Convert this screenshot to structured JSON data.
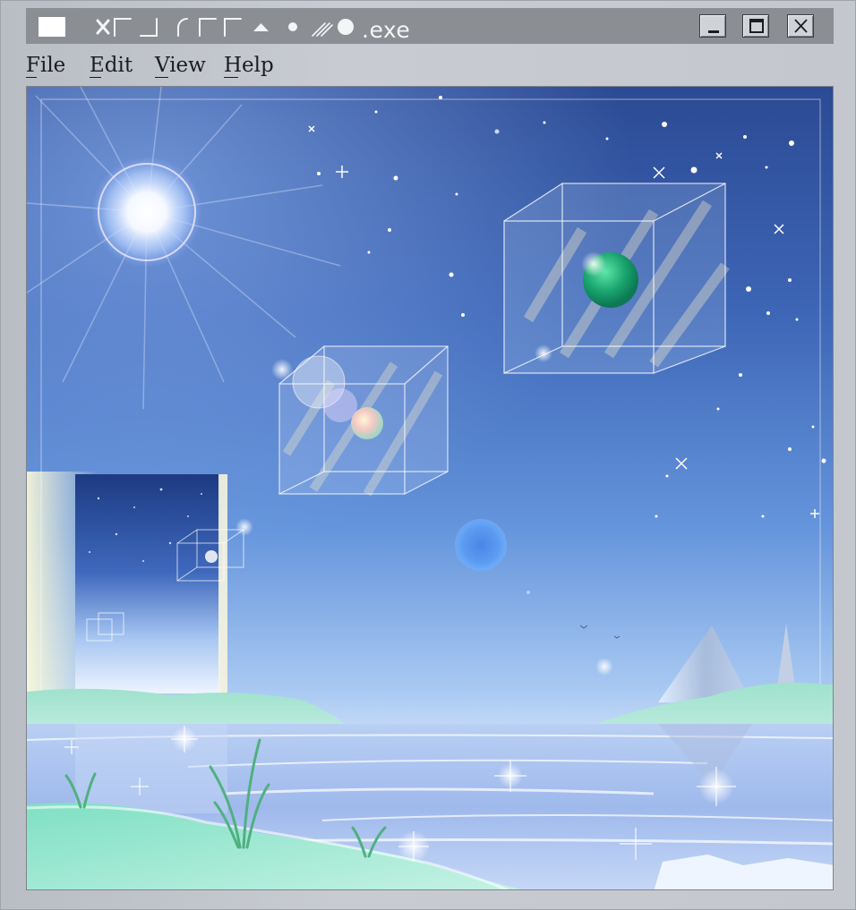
{
  "window": {
    "title": ".exe",
    "title_icon_glyphs": [
      "x-icon",
      "corner-icon",
      "corner-icon",
      "arc-icon",
      "corner-icon",
      "corner-icon",
      "triangle-icon",
      "dot-icon",
      "slash-icon",
      "circle-icon"
    ],
    "controls": {
      "minimize": "minimize-icon",
      "maximize": "maximize-icon",
      "close": "close-icon"
    }
  },
  "menu": {
    "file": "File",
    "edit": "Edit",
    "view": "View",
    "help": "Help"
  },
  "scene": {
    "description_colors": {
      "sky_top": "#2c4a94",
      "sky_mid": "#5f8ed6",
      "horizon": "#dfeeff",
      "grass": "#a7ebd7",
      "cube_sphere": "#1aa56f"
    }
  }
}
